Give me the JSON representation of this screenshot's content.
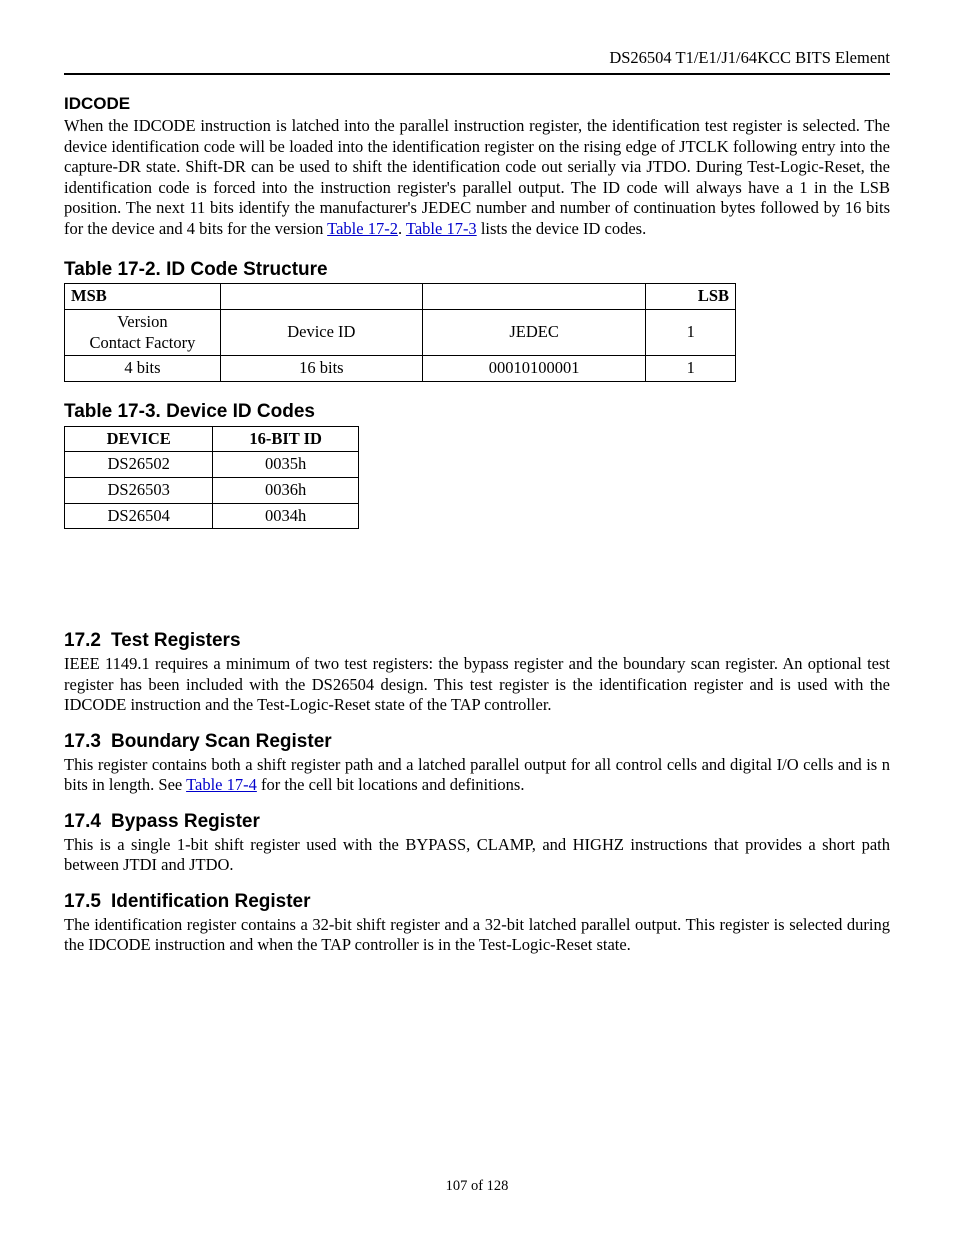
{
  "header": {
    "running_title": "DS26504 T1/E1/J1/64KCC BITS Element"
  },
  "idcode": {
    "heading": "IDCODE",
    "para_a": "When the IDCODE instruction is latched into the parallel instruction register, the identification test register is selected. The device identification code will be loaded into the identification register on the rising edge of JTCLK following entry into the capture-DR state. Shift-DR can be used to shift the identification code out serially via JTDO. During Test-Logic-Reset, the identification code is forced into the instruction register's parallel output. The ID code will always have a 1 in the LSB position. The next 11 bits identify the manufacturer's JEDEC number and number of continuation bytes followed by 16 bits for the device and 4 bits for the version ",
    "link1": "Table 17-2",
    "para_b": ". ",
    "link2": "Table 17-3",
    "para_c": " lists the device ID codes."
  },
  "tbl172": {
    "title": "Table 17-2. ID Code Structure",
    "msb": "MSB",
    "lsb": "LSB",
    "r2c1a": "Version",
    "r2c1b": "Contact Factory",
    "r2c2": "Device ID",
    "r2c3": "JEDEC",
    "r2c4": "1",
    "r3c1": "4 bits",
    "r3c2": "16 bits",
    "r3c3": "00010100001",
    "r3c4": "1"
  },
  "tbl173": {
    "title": "Table 17-3. Device ID Codes",
    "h1": "DEVICE",
    "h2": "16-BIT ID",
    "rows": [
      {
        "device": "DS26502",
        "id": "0035h"
      },
      {
        "device": "DS26503",
        "id": "0036h"
      },
      {
        "device": "DS26504",
        "id": "0034h"
      }
    ]
  },
  "sections": {
    "s172": {
      "num": "17.2",
      "title": "Test Registers",
      "body": "IEEE 1149.1 requires a minimum of two test registers: the bypass register and the boundary scan register. An optional test register has been included with the DS26504 design. This test register is the identification register and is used with the IDCODE instruction and the Test-Logic-Reset state of the TAP controller."
    },
    "s173": {
      "num": "17.3",
      "title": "Boundary Scan Register",
      "body_a": "This register contains both a shift register path and a latched parallel output for all control cells and digital I/O cells and is n bits in length.  See ",
      "link": "Table 17-4",
      "body_b": " for the cell bit locations and definitions."
    },
    "s174": {
      "num": "17.4",
      "title": "Bypass Register",
      "body": "This is a single 1-bit shift register used with the BYPASS, CLAMP, and HIGHZ instructions that provides a short path between JTDI and JTDO."
    },
    "s175": {
      "num": "17.5",
      "title": "Identification Register",
      "body": "The identification register contains a 32-bit shift register and a 32-bit latched parallel output. This register is selected during the IDCODE instruction and when the TAP controller is in the Test-Logic-Reset state."
    }
  },
  "footer": {
    "pager": "107 of 128"
  }
}
